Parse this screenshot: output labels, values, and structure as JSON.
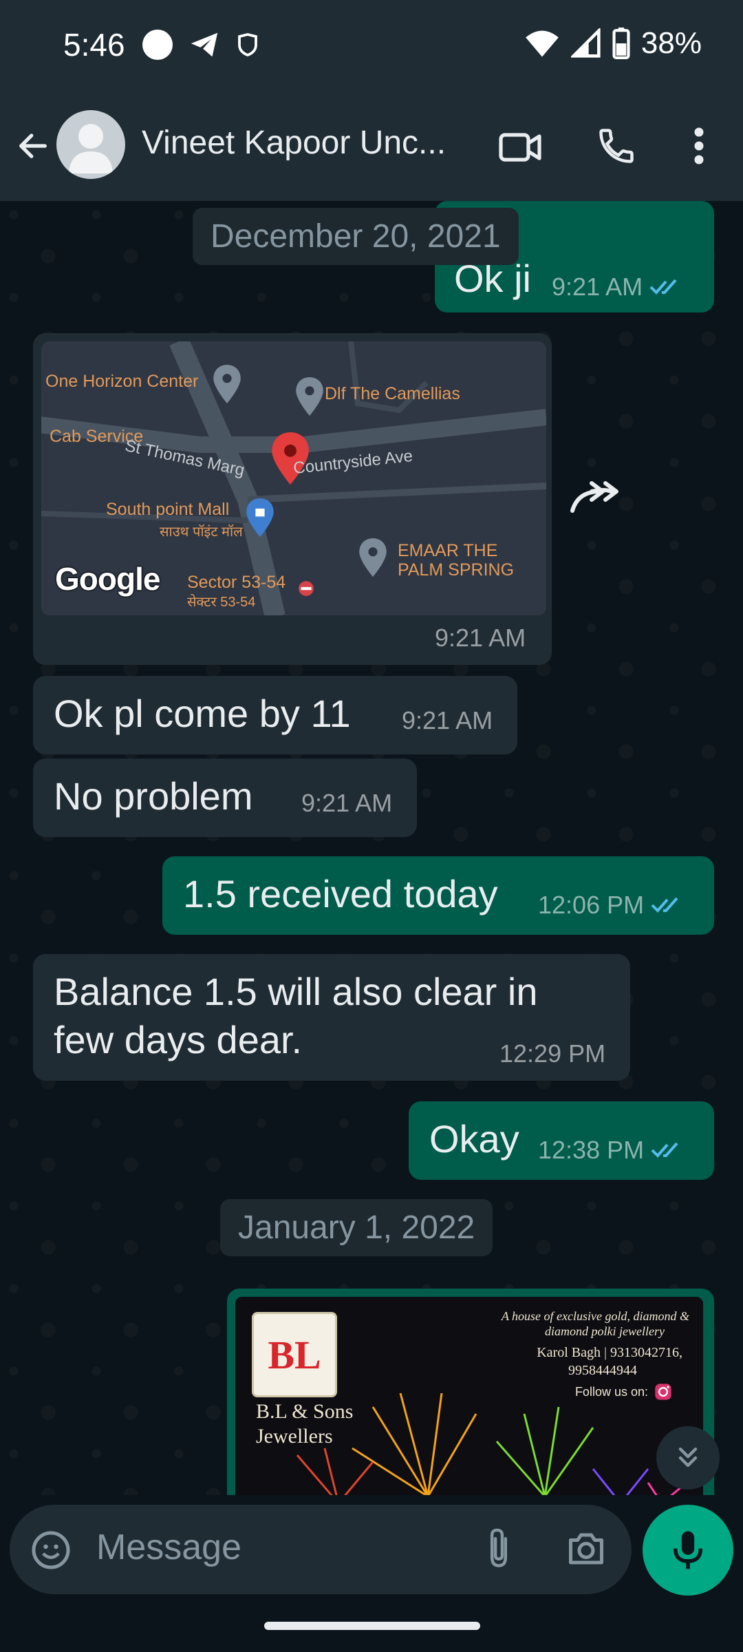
{
  "status_bar": {
    "time": "5:46",
    "battery": "38%"
  },
  "header": {
    "contact_name": "Vineet Kapoor Unc..."
  },
  "chat": {
    "date_1": "December 20, 2021",
    "msg_top": {
      "text": "Ok ji",
      "time": "9:21 AM"
    },
    "location": {
      "time": "9:21 AM",
      "places": {
        "one_horizon": "One Horizon Center",
        "camellias": "Dlf The Camellias",
        "cab": "Cab Service",
        "st_thomas": "St Thomas Marg",
        "countryside": "Countryside Ave",
        "south_point": "South point Mall",
        "south_point_hi": "साउथ पॉइंट मॉल",
        "emaar": "EMAAR THE",
        "emaar2": "PALM SPRING",
        "sector": "Sector 53-54",
        "sector_hi": "सेक्टर 53-54"
      },
      "google": "Google"
    },
    "msg_1": {
      "text": "Ok pl come by 11",
      "time": "9:21 AM"
    },
    "msg_2": {
      "text": "No problem",
      "time": "9:21 AM"
    },
    "msg_3": {
      "text": "1.5 received today",
      "time": "12:06 PM"
    },
    "msg_4": {
      "text_line1": "Balance 1.5 will also clear in",
      "text_line2": "few days dear.",
      "time": "12:29 PM"
    },
    "msg_5": {
      "text": "Okay",
      "time": "12:38 PM"
    },
    "date_2": "January 1, 2022",
    "image_card": {
      "tagline1": "A house of exclusive gold, diamond &",
      "tagline2": "diamond polki jewellery",
      "address": "Karol Bagh | 9313042716,",
      "phone2": "9958444944",
      "follow": "Follow us on:",
      "brand1": "B.L & Sons",
      "brand2": "Jewellers",
      "logo": "BL"
    }
  },
  "input": {
    "placeholder": "Message"
  },
  "colors": {
    "outgoing": "#005c4b",
    "incoming": "#202c33",
    "accent": "#00a884",
    "tick": "#53bdeb"
  }
}
